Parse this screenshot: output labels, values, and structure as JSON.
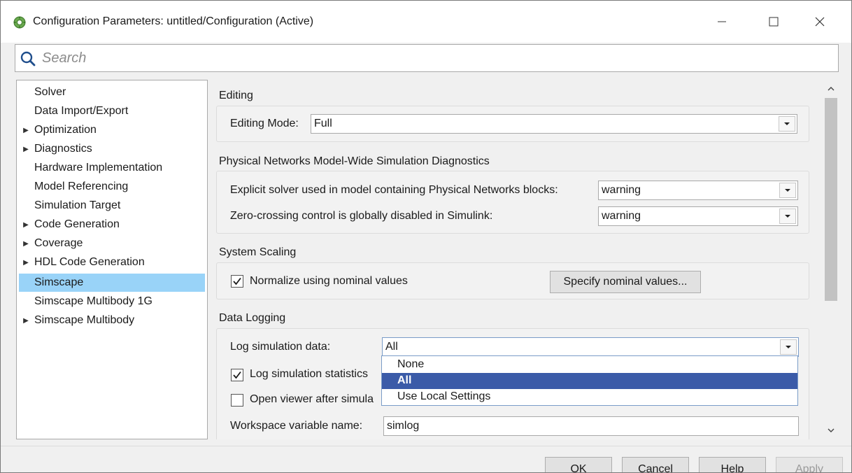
{
  "window": {
    "title": "Configuration Parameters: untitled/Configuration (Active)",
    "controls": {
      "minimize": "—",
      "maximize": "☐",
      "close": "✕"
    }
  },
  "search": {
    "placeholder": "Search",
    "value": ""
  },
  "tree": {
    "items": [
      {
        "label": "Solver",
        "expandable": false
      },
      {
        "label": "Data Import/Export",
        "expandable": false
      },
      {
        "label": "Optimization",
        "expandable": true
      },
      {
        "label": "Diagnostics",
        "expandable": true
      },
      {
        "label": "Hardware Implementation",
        "expandable": false
      },
      {
        "label": "Model Referencing",
        "expandable": false
      },
      {
        "label": "Simulation Target",
        "expandable": false
      },
      {
        "label": "Code Generation",
        "expandable": true
      },
      {
        "label": "Coverage",
        "expandable": true
      },
      {
        "label": "HDL Code Generation",
        "expandable": true
      },
      {
        "label": "Simscape",
        "expandable": false,
        "selected": true
      },
      {
        "label": "Simscape Multibody 1G",
        "expandable": false
      },
      {
        "label": "Simscape Multibody",
        "expandable": true
      }
    ]
  },
  "editing": {
    "title": "Editing",
    "mode_label": "Editing Mode:",
    "mode_value": "Full"
  },
  "physical": {
    "title": "Physical Networks Model-Wide Simulation Diagnostics",
    "explicit_label": "Explicit solver used in model containing Physical Networks blocks:",
    "explicit_value": "warning",
    "zero_label": "Zero-crossing control is globally disabled in Simulink:",
    "zero_value": "warning"
  },
  "scaling": {
    "title": "System Scaling",
    "normalize_label": "Normalize using nominal values",
    "normalize_checked": true,
    "specify_button": "Specify nominal values..."
  },
  "logging": {
    "title": "Data Logging",
    "log_label": "Log simulation data:",
    "log_value": "All",
    "stats_label": "Log simulation statistics",
    "stats_checked": true,
    "viewer_label": "Open viewer after simula",
    "viewer_checked": false,
    "workspace_label": "Workspace variable name:",
    "workspace_value": "simlog",
    "options": [
      "None",
      "All",
      "Use Local Settings"
    ],
    "selected_option": "All"
  },
  "footer": {
    "ok": "OK",
    "cancel": "Cancel",
    "help": "Help",
    "apply": "Apply"
  },
  "colors": {
    "selection_tree": "#99d3f8",
    "selection_dropdown": "#3b5ba8",
    "panel_bg": "#f0f0f0"
  }
}
